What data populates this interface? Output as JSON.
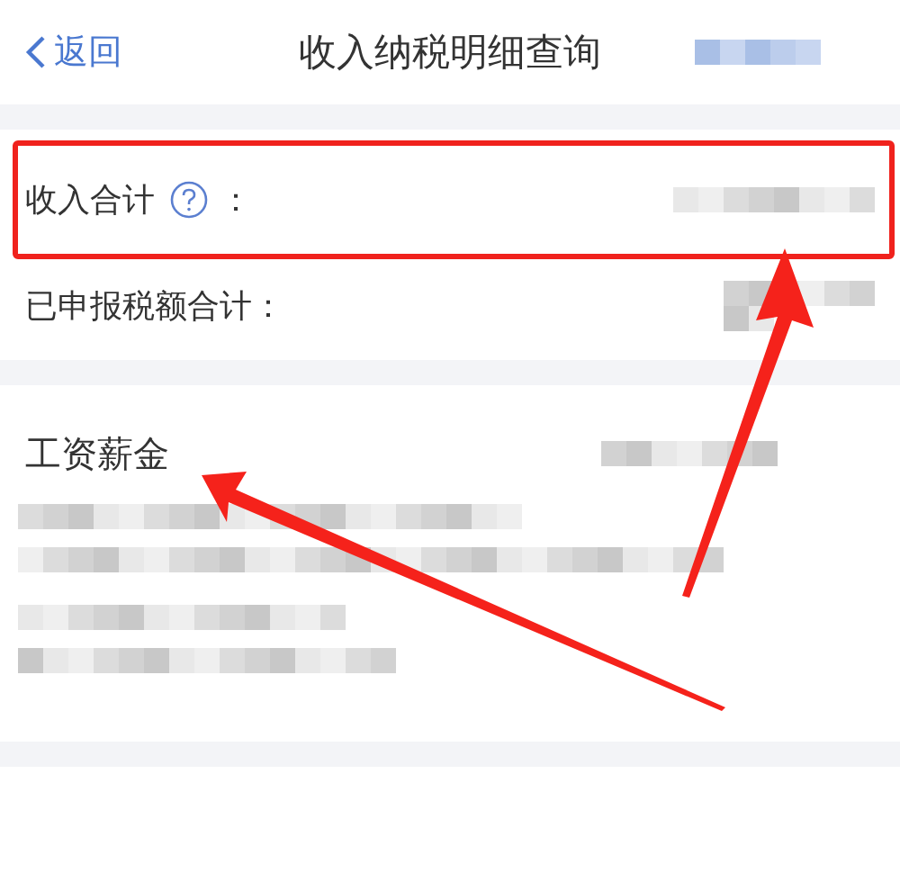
{
  "header": {
    "back": "返回",
    "title": "收入纳税明细查询"
  },
  "summary": [
    {
      "label": "收入合计",
      "help": true,
      "suffix": "："
    },
    {
      "label": "已申报税额合计：",
      "help": false
    }
  ],
  "section": {
    "title": "工资薪金"
  }
}
